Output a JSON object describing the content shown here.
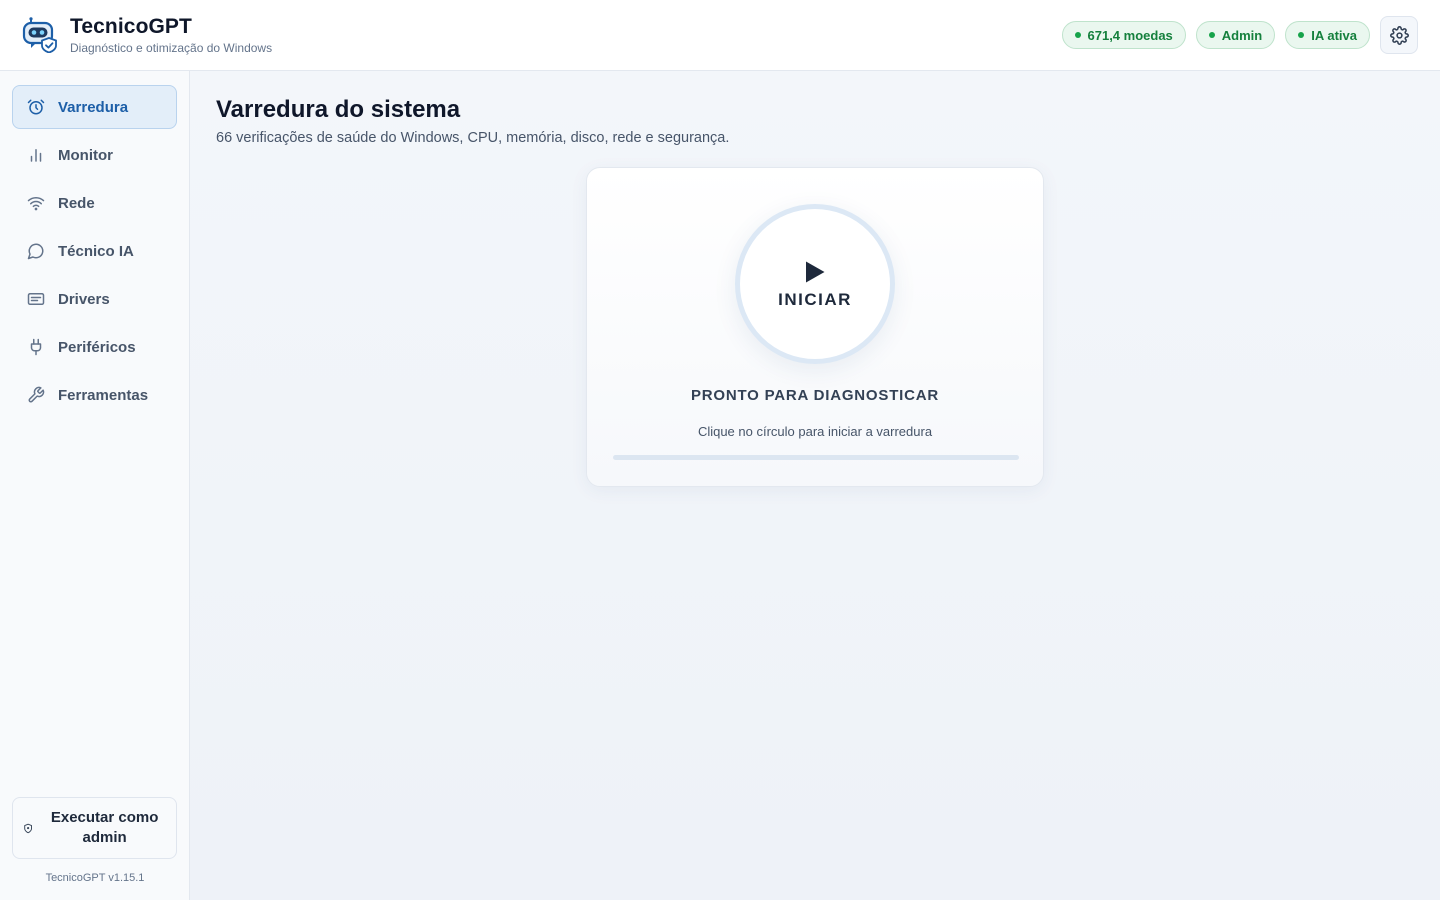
{
  "app": {
    "title": "TecnicoGPT",
    "subtitle": "Diagnóstico e otimização do Windows"
  },
  "header": {
    "badges": [
      {
        "label": "671,4 moedas"
      },
      {
        "label": "Admin"
      },
      {
        "label": "IA ativa"
      }
    ],
    "settings_icon": "gear-icon"
  },
  "sidebar": {
    "items": [
      {
        "label": "Varredura",
        "icon": "alarm-clock-icon",
        "active": true
      },
      {
        "label": "Monitor",
        "icon": "bar-chart-icon",
        "active": false
      },
      {
        "label": "Rede",
        "icon": "wifi-icon",
        "active": false
      },
      {
        "label": "Técnico IA",
        "icon": "chat-bubble-icon",
        "active": false
      },
      {
        "label": "Drivers",
        "icon": "drive-icon",
        "active": false
      },
      {
        "label": "Periféricos",
        "icon": "plug-icon",
        "active": false
      },
      {
        "label": "Ferramentas",
        "icon": "wrench-icon",
        "active": false
      }
    ],
    "admin_button": "Executar como admin",
    "version": "TecnicoGPT v1.15.1"
  },
  "main": {
    "title": "Varredura do sistema",
    "subtitle": "66 verificações de saúde do Windows, CPU, memória, disco, rede e segurança.",
    "scan": {
      "button_label": "INICIAR",
      "status": "PRONTO PARA DIAGNOSTICAR",
      "hint": "Clique no círculo para iniciar a varredura",
      "progress": 0
    }
  },
  "colors": {
    "accent": "#1d5fa8",
    "active_bg": "#e3eef9",
    "success": "#16a34a",
    "success_bg": "#eaf7ef"
  }
}
